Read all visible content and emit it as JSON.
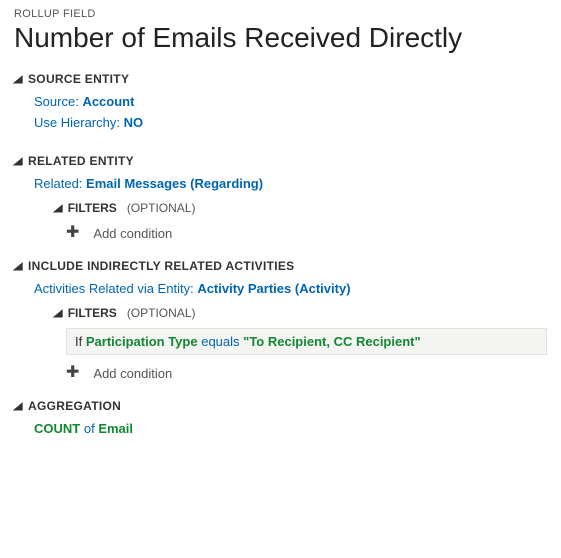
{
  "header": {
    "breadcrumb": "ROLLUP FIELD",
    "title": "Number of Emails Received Directly"
  },
  "sections": {
    "source": {
      "title": "SOURCE ENTITY",
      "sourceLabel": "Source:",
      "sourceValue": "Account",
      "hierarchyLabel": "Use Hierarchy:",
      "hierarchyValue": "NO"
    },
    "related": {
      "title": "RELATED ENTITY",
      "relatedLabel": "Related:",
      "relatedValue": "Email Messages",
      "relatedParen": "Regarding",
      "filters": {
        "title": "FILTERS",
        "optional": "(OPTIONAL)",
        "addLabel": "Add condition"
      }
    },
    "indirect": {
      "title": "INCLUDE INDIRECTLY RELATED ACTIVITIES",
      "viaLabel": "Activities Related via Entity:",
      "viaValue": "Activity Parties",
      "viaParen": "Activity",
      "filters": {
        "title": "FILTERS",
        "optional": "(OPTIONAL)",
        "condition": {
          "if": "If",
          "field": "Participation Type",
          "op": "equals",
          "value": "\"To Recipient, CC Recipient\""
        },
        "addLabel": "Add condition"
      }
    },
    "aggregation": {
      "title": "AGGREGATION",
      "func": "COUNT",
      "of": "of",
      "field": "Email"
    }
  }
}
